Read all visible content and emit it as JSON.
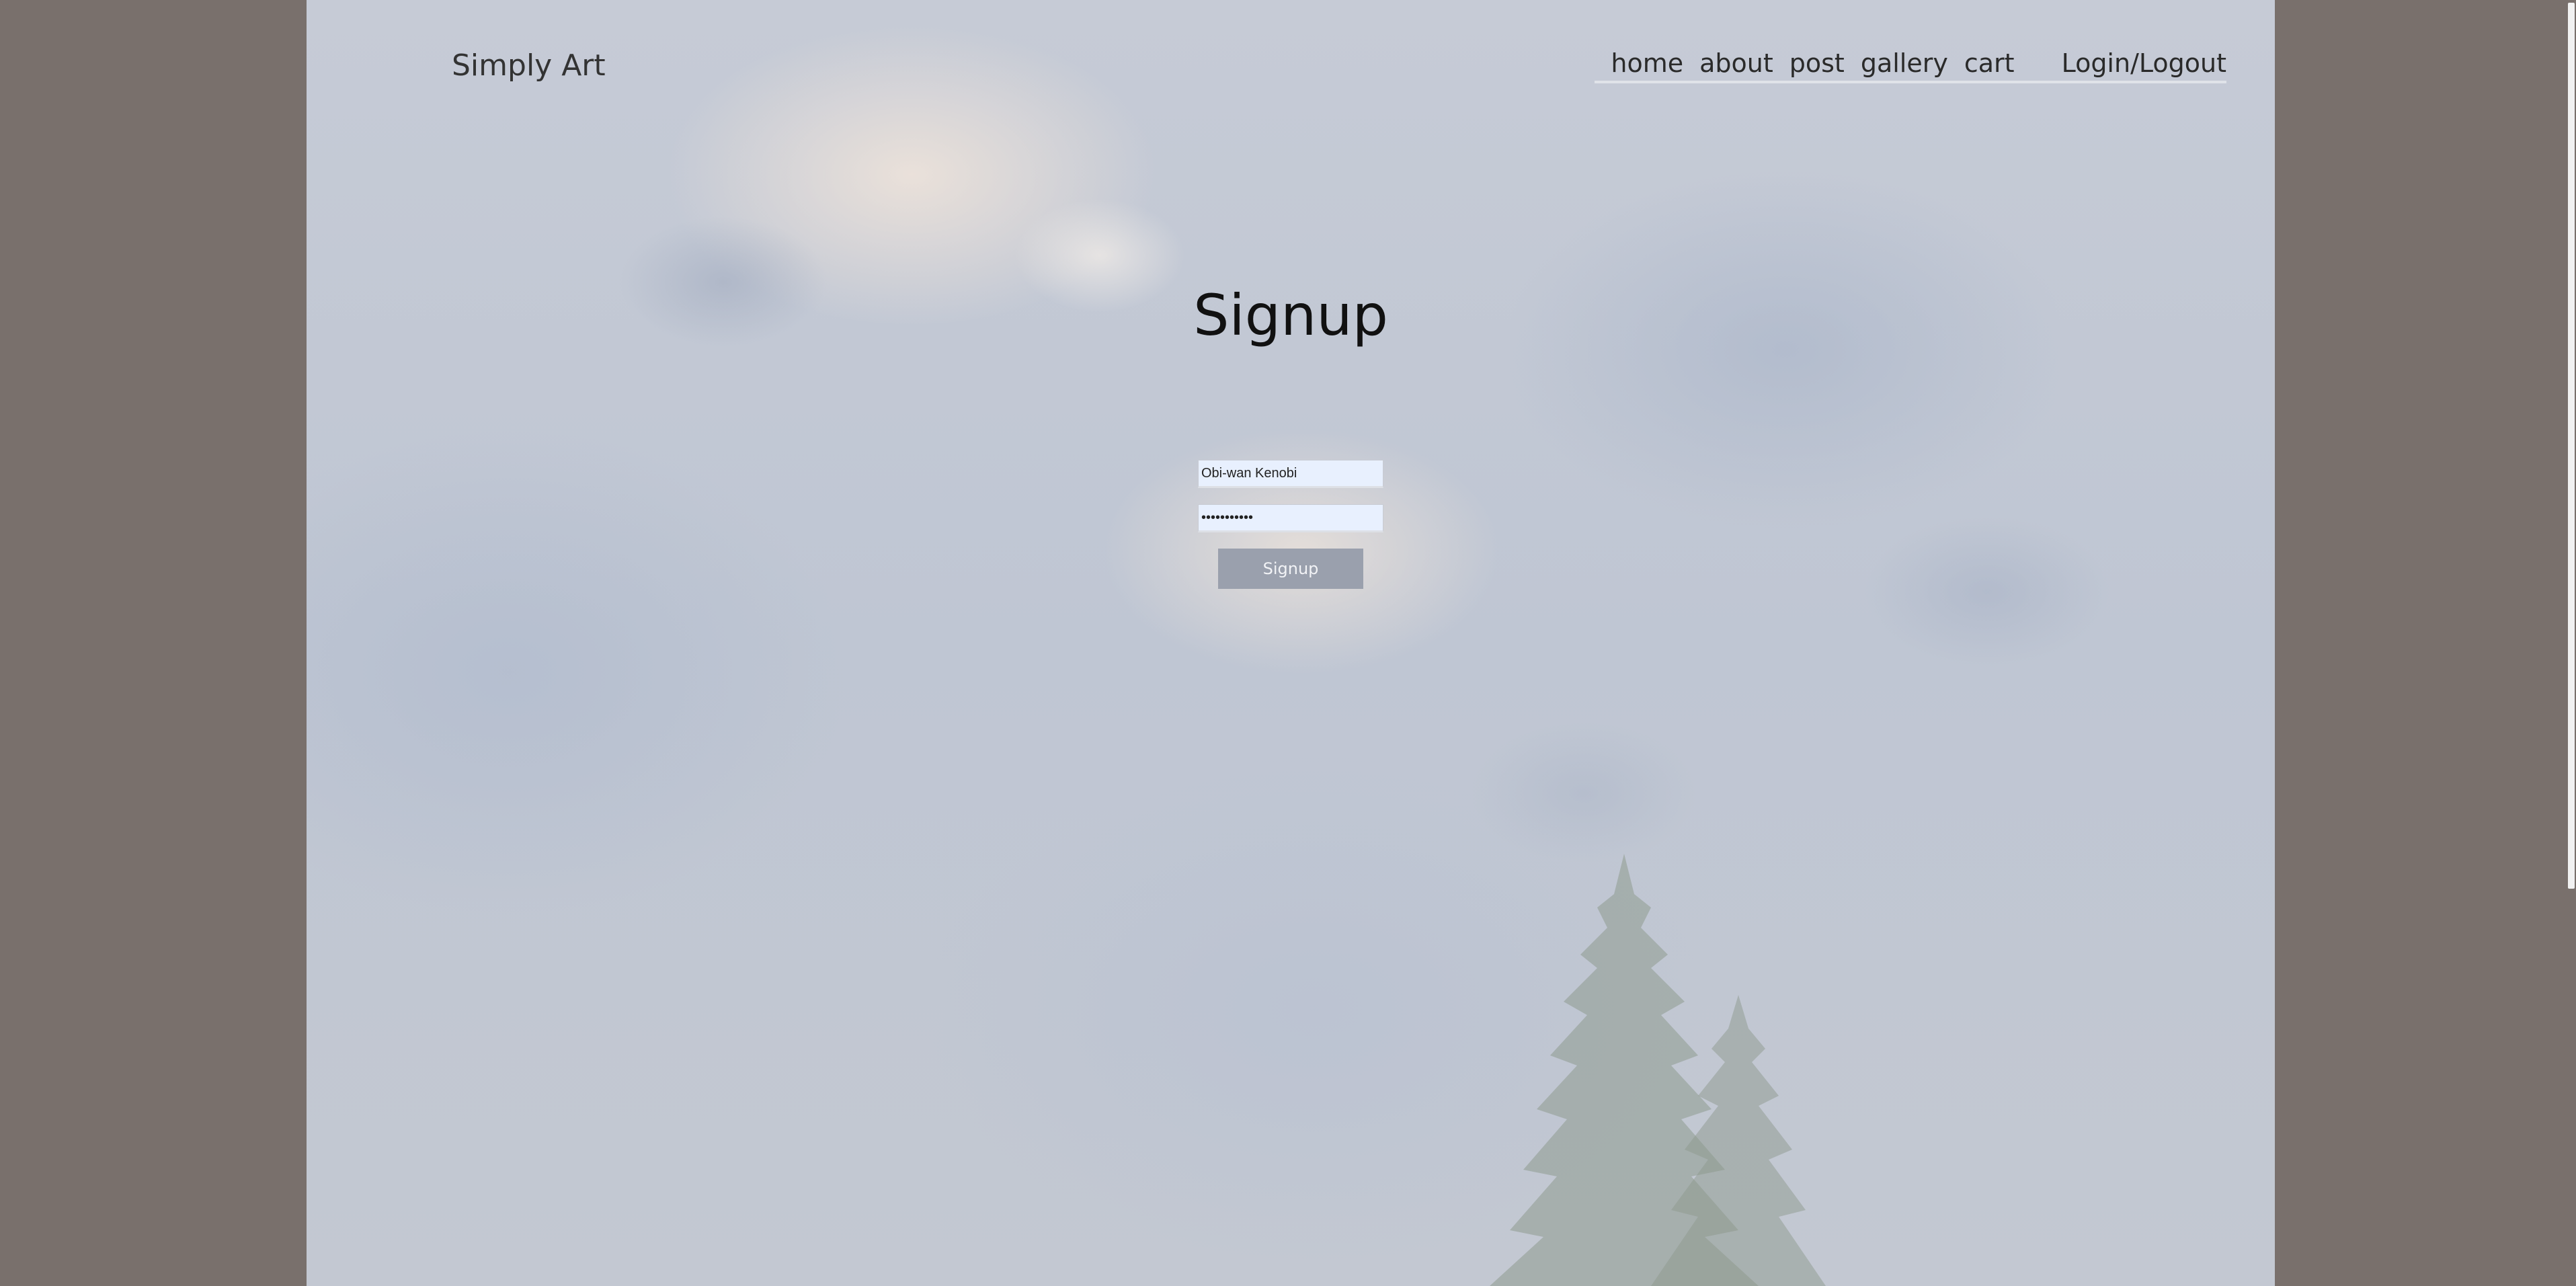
{
  "header": {
    "brand": "Simply Art",
    "nav": [
      "home",
      "about",
      "post",
      "gallery",
      "cart"
    ],
    "login": "Login/Logout"
  },
  "signup": {
    "title": "Signup",
    "username_value": "Obi-wan Kenobi",
    "password_value": "kenobi12345",
    "submit_label": "Signup"
  },
  "colors": {
    "outer_background": "#79706c",
    "button": "#9aa0ad",
    "input_autofill": "#e8f0fe"
  }
}
